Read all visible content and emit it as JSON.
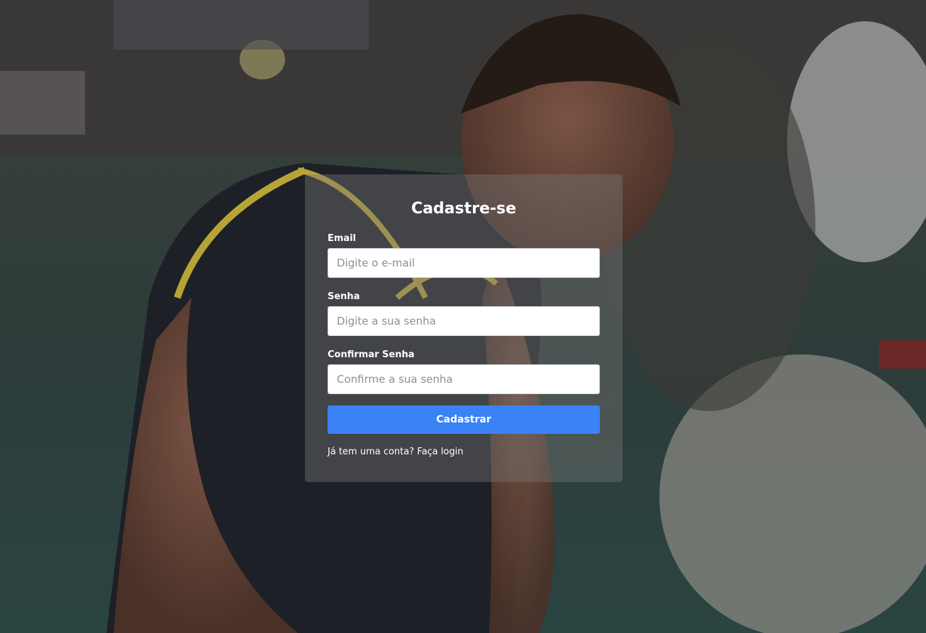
{
  "form": {
    "title": "Cadastre-se",
    "email": {
      "label": "Email",
      "placeholder": "Digite o e-mail",
      "value": ""
    },
    "password": {
      "label": "Senha",
      "placeholder": "Digite a sua senha",
      "value": ""
    },
    "confirm_password": {
      "label": "Confirmar Senha",
      "placeholder": "Confirme a sua senha",
      "value": ""
    },
    "submit_label": "Cadastrar",
    "login_prompt": "Já tem uma conta?",
    "login_link": "Faça login"
  },
  "colors": {
    "accent": "#3b82f6",
    "card_overlay": "rgba(120,120,120,0.42)",
    "text": "#ffffff"
  }
}
